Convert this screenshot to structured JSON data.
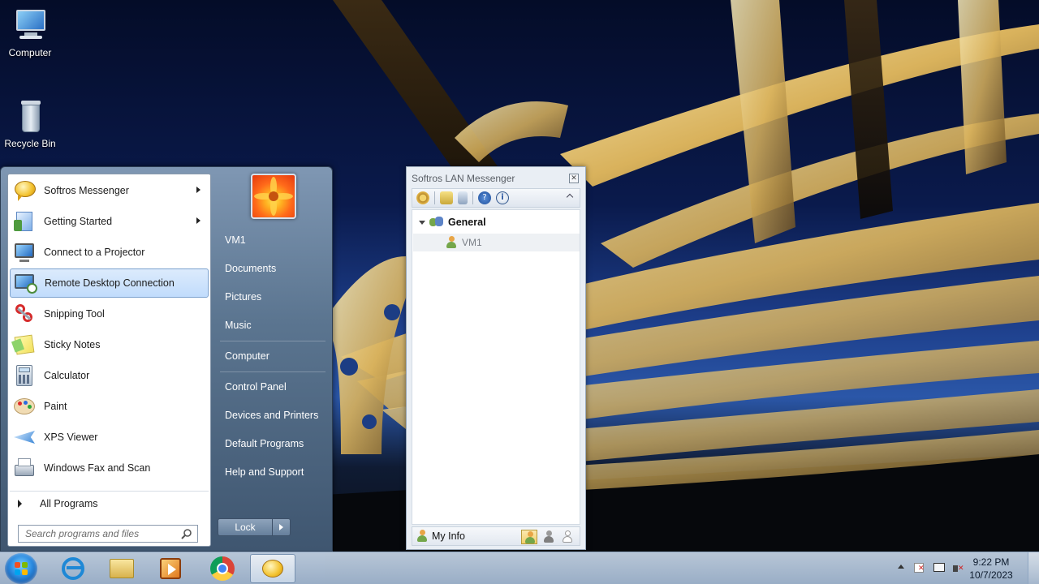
{
  "desktop": {
    "icons": [
      {
        "label": "Computer",
        "icon": "computer-icon"
      },
      {
        "label": "Recycle Bin",
        "icon": "recycle-bin-icon"
      }
    ]
  },
  "start_menu": {
    "programs": [
      {
        "label": "Softros Messenger",
        "icon": "softros-messenger-icon",
        "has_submenu": true
      },
      {
        "label": "Getting Started",
        "icon": "getting-started-icon",
        "has_submenu": true
      },
      {
        "label": "Connect to a Projector",
        "icon": "projector-icon",
        "has_submenu": false
      },
      {
        "label": "Remote Desktop Connection",
        "icon": "remote-desktop-icon",
        "has_submenu": false,
        "selected": true
      },
      {
        "label": "Snipping Tool",
        "icon": "snipping-tool-icon",
        "has_submenu": false
      },
      {
        "label": "Sticky Notes",
        "icon": "sticky-notes-icon",
        "has_submenu": false
      },
      {
        "label": "Calculator",
        "icon": "calculator-icon",
        "has_submenu": false
      },
      {
        "label": "Paint",
        "icon": "paint-icon",
        "has_submenu": false
      },
      {
        "label": "XPS Viewer",
        "icon": "xps-viewer-icon",
        "has_submenu": false
      },
      {
        "label": "Windows Fax and Scan",
        "icon": "fax-scan-icon",
        "has_submenu": false
      }
    ],
    "all_programs": "All Programs",
    "search_placeholder": "Search programs and files",
    "right_links": {
      "user": "VM1",
      "documents": "Documents",
      "pictures": "Pictures",
      "music": "Music",
      "computer": "Computer",
      "control_panel": "Control Panel",
      "devices_printers": "Devices and Printers",
      "default_programs": "Default Programs",
      "help_support": "Help and Support"
    },
    "lock_label": "Lock"
  },
  "messenger": {
    "title": "Softros LAN Messenger",
    "toolbar_icons": [
      "settings-icon",
      "open-folder-icon",
      "history-icon",
      "help-icon",
      "info-icon"
    ],
    "group": {
      "name": "General",
      "icon": "group-icon"
    },
    "users": [
      {
        "name": "VM1",
        "icon": "user-icon"
      }
    ],
    "my_info": "My Info",
    "status_icons": [
      "status-available-icon",
      "status-away-icon",
      "status-offline-icon"
    ]
  },
  "taskbar": {
    "apps": [
      "internet-explorer-icon",
      "file-explorer-icon",
      "media-player-icon",
      "chrome-icon",
      "softros-messenger-icon"
    ],
    "active_app": "softros-messenger-icon",
    "clock_time": "9:22 PM",
    "clock_date": "10/7/2023"
  },
  "colors": {
    "selection_bg": "#c1dcfc",
    "start_menu_frame": "#5b7590",
    "taskbar": "#b6c9df"
  }
}
